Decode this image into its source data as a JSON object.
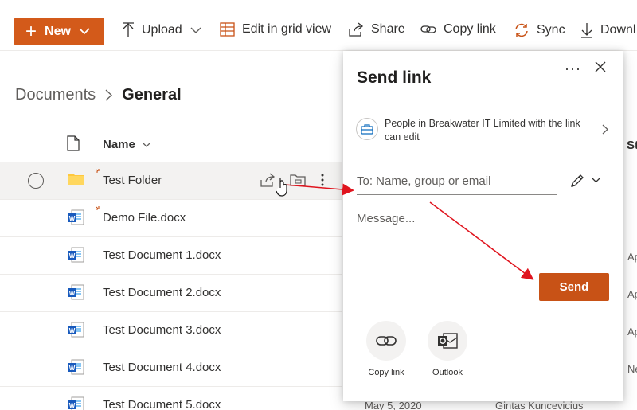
{
  "toolbar": {
    "new_label": "New",
    "upload_label": "Upload",
    "edit_grid_label": "Edit in grid view",
    "share_label": "Share",
    "copy_link_label": "Copy link",
    "sync_label": "Sync",
    "download_label": "Downl"
  },
  "breadcrumb": {
    "parent": "Documents",
    "current": "General"
  },
  "list": {
    "name_header": "Name",
    "right_header_stub": "St",
    "files": [
      {
        "name": "Test Folder",
        "type": "folder"
      },
      {
        "name": "Demo File.docx",
        "type": "word"
      },
      {
        "name": "Test Document 1.docx",
        "type": "word"
      },
      {
        "name": "Test Document 2.docx",
        "type": "word"
      },
      {
        "name": "Test Document 3.docx",
        "type": "word"
      },
      {
        "name": "Test Document 4.docx",
        "type": "word"
      },
      {
        "name": "Test Document 5.docx",
        "type": "word"
      }
    ],
    "right_stubs": [
      "Ap",
      "Ap",
      "Ap",
      "Ne"
    ],
    "peek_modified": "May 5, 2020",
    "peek_modified_by": "Gintas Kuncevicius"
  },
  "send_link": {
    "title": "Send link",
    "more_icon": "more-horizontal-icon",
    "close_icon": "close-icon",
    "permission_text": "People in Breakwater IT Limited with the link can edit",
    "to_placeholder": "To: Name, group or email",
    "message_placeholder": "Message...",
    "send_label": "Send",
    "options": [
      {
        "label": "Copy link",
        "icon": "link-icon"
      },
      {
        "label": "Outlook",
        "icon": "outlook-icon"
      }
    ]
  },
  "colors": {
    "accent": "#d35a1a",
    "send": "#c85216",
    "annotation_arrow": "#e0141e"
  }
}
